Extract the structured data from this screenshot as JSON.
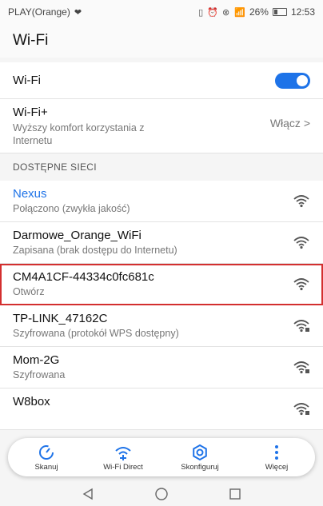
{
  "status_bar": {
    "carrier": "PLAY(Orange)",
    "icons": "▯ ⏰ ⊗",
    "battery_percent": "26%",
    "time": "12:53"
  },
  "app_bar": {
    "title": "Wi-Fi"
  },
  "wifi_toggle": {
    "label": "Wi-Fi",
    "on": true
  },
  "wifi_plus": {
    "title": "Wi-Fi+",
    "description": "Wyższy komfort korzystania z Internetu",
    "action": "Włącz >"
  },
  "section": {
    "header": "DOSTĘPNE SIECI"
  },
  "networks": [
    {
      "name": "Nexus",
      "state": "Połączono (zwykła jakość)",
      "connected": true,
      "secured": false
    },
    {
      "name": "Darmowe_Orange_WiFi",
      "state": "Zapisana (brak dostępu do Internetu)",
      "connected": false,
      "secured": false
    },
    {
      "name": "CM4A1CF-44334c0fc681c",
      "state": "Otwórz",
      "connected": false,
      "secured": false,
      "highlighted": true
    },
    {
      "name": "TP-LINK_47162C",
      "state": "Szyfrowana (protokół WPS dostępny)",
      "connected": false,
      "secured": true
    },
    {
      "name": "Mom-2G",
      "state": "Szyfrowana",
      "connected": false,
      "secured": true
    },
    {
      "name": "W8box",
      "state": "",
      "connected": false,
      "secured": true
    }
  ],
  "toolbar": {
    "scan": "Skanuj",
    "wifi_direct": "Wi-Fi Direct",
    "configure": "Skonfiguruj",
    "more": "Więcej"
  },
  "colors": {
    "accent": "#1e73e8",
    "highlight_border": "#d32f2f"
  }
}
